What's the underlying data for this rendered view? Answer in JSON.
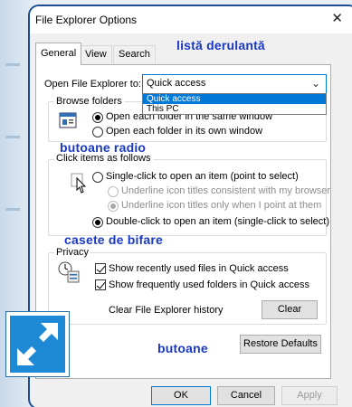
{
  "window": {
    "title": "File Explorer Options",
    "close_glyph": "✕"
  },
  "tabs": [
    {
      "label": "General"
    },
    {
      "label": "View"
    },
    {
      "label": "Search"
    }
  ],
  "annotations": {
    "dropdown": "listă derulantă",
    "radio": "butoane radio",
    "checkbox": "casete de bifare",
    "buttons": "butoane"
  },
  "open_explorer": {
    "label_pre": "Open File Explorer to:",
    "value": "Quick access",
    "options": [
      "Quick access",
      "This PC"
    ]
  },
  "browse_folders": {
    "title": "Browse folders",
    "options": [
      {
        "label": "Open each folder in the same window",
        "selected": true
      },
      {
        "label": "Open each folder in its own window",
        "selected": false
      }
    ]
  },
  "click_items": {
    "title": "Click items as follows",
    "single": "Single-click to open an item (point to select)",
    "underline_browser": "Underline icon titles consistent with my browser",
    "underline_point": "Underline icon titles only when I point at them",
    "double": "Double-click to open an item (single-click to select)"
  },
  "privacy": {
    "title": "Privacy",
    "recent_files": "Show recently used files in Quick access",
    "frequent_folders": "Show frequently used folders in Quick access",
    "clear_history_label": "Clear File Explorer history",
    "clear_button": "Clear"
  },
  "restore_defaults": "Restore Defaults",
  "footer": {
    "ok": "OK",
    "cancel": "Cancel",
    "apply": "Apply"
  },
  "colors": {
    "accent": "#0078d7",
    "annotation": "#1a39c2",
    "window_border": "#1b4f91",
    "expand_icon": "#1e8ad6"
  },
  "icons": [
    "window-icon",
    "cursor-hand-icon",
    "privacy-icon",
    "expand-arrows-icon",
    "dropdown-arrow-icon",
    "close-icon"
  ]
}
